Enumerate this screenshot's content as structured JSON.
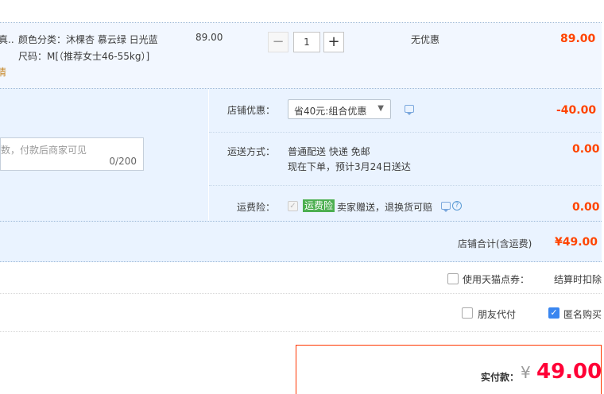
{
  "item": {
    "name_fragment": "真..",
    "color_label": "颜色分类：沐棵杏 慕云绿 日光蓝",
    "size_label": "尺码：M[（推荐女士46-55kg）]",
    "tag_fragment": "情",
    "unit_price": "89.00",
    "quantity": "1",
    "minus_symbol": "−",
    "plus_symbol": "+",
    "discount_text": "无优惠",
    "subtotal": "89.00"
  },
  "message": {
    "placeholder": "数，付款后商家可见",
    "count": "0/200"
  },
  "shop_discount": {
    "label": "店铺优惠：",
    "selected": "省40元:组合优惠",
    "amount": "-40.00"
  },
  "shipping": {
    "label": "运送方式：",
    "method": "普通配送 快递 免邮",
    "eta": "现在下单，预计3月24日送达",
    "amount": "0.00"
  },
  "insurance": {
    "label": "运费险：",
    "tag": "运费险",
    "desc": "卖家赠送，退换货可赔",
    "amount": "0.00",
    "question_mark": "?"
  },
  "shop_total": {
    "label": "店铺合计(含运费)",
    "amount": "¥49.00"
  },
  "points": {
    "label": "使用天猫点券：",
    "note": "结算时扣除"
  },
  "options_row": {
    "friend_pay": "朋友代付",
    "anonymous": "匿名购买"
  },
  "payment": {
    "label": "实付款：",
    "currency": "¥",
    "amount": "49.00"
  },
  "colors": {
    "accent_red": "#ff0036",
    "price_red": "#ff4400",
    "checkbox_blue": "#3a86f0",
    "tag_green": "#4caf50"
  }
}
